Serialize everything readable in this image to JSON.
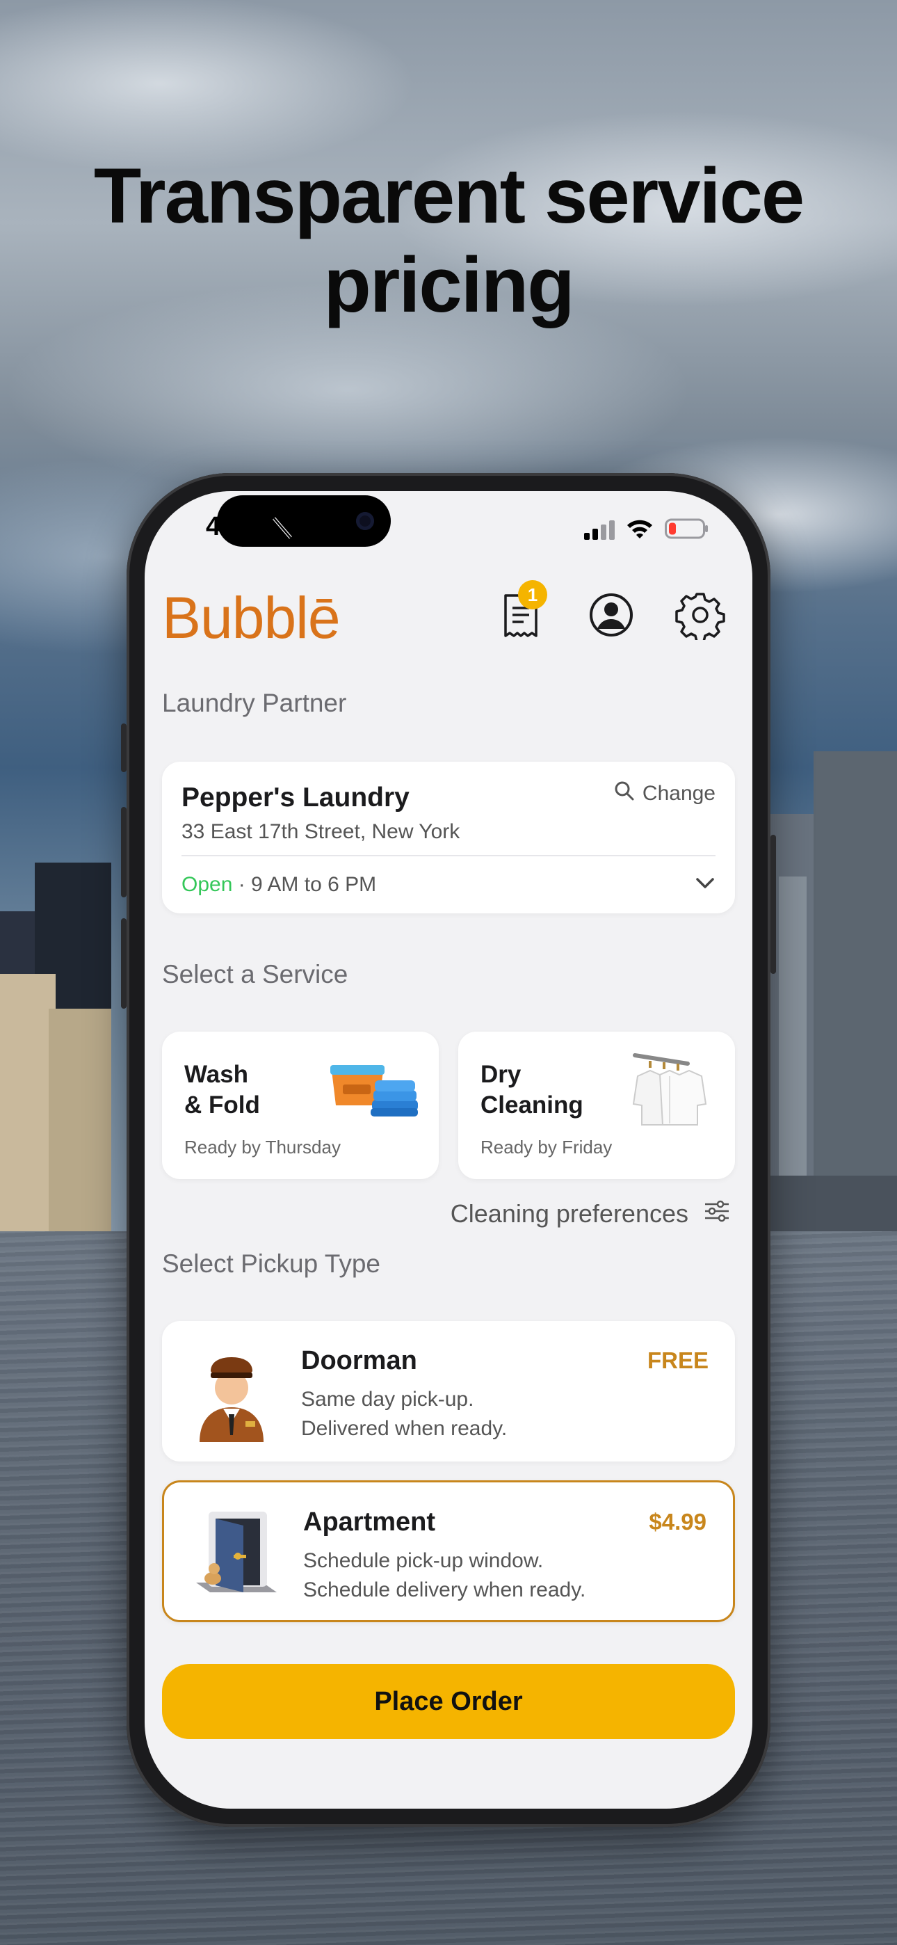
{
  "headline": {
    "line1": "Transparent service",
    "line2": "pricing"
  },
  "status_bar": {
    "time": "4:38",
    "icons": [
      "bell-slash-icon",
      "signal-icon",
      "wifi-icon",
      "battery-low-icon"
    ]
  },
  "app": {
    "logo": "Bubblē",
    "header_icons": [
      "receipt-icon",
      "profile-icon",
      "gear-icon"
    ],
    "receipt_badge": "1",
    "brand_color": "#d9731a",
    "accent_color": "#f5b400"
  },
  "partner_section": {
    "title": "Laundry Partner",
    "name": "Pepper's Laundry",
    "address": "33 East 17th Street, New York",
    "change_label": "Change",
    "status": "Open",
    "hours": " · 9 AM to 6 PM"
  },
  "service_section": {
    "title": "Select a Service",
    "services": [
      {
        "name_line1": "Wash",
        "name_line2": "& Fold",
        "ready": "Ready by Thursday",
        "icon": "laundry-basket-icon"
      },
      {
        "name_line1": "Dry",
        "name_line2": "Cleaning",
        "ready": "Ready by Friday",
        "icon": "shirts-on-hangers-icon"
      }
    ],
    "preferences_label": "Cleaning preferences"
  },
  "pickup_section": {
    "title": "Select Pickup Type",
    "options": [
      {
        "name": "Doorman",
        "price": "FREE",
        "line1": "Same day pick-up.",
        "line2": "Delivered when ready.",
        "icon": "doorman-icon",
        "selected": false
      },
      {
        "name": "Apartment",
        "price": "$4.99",
        "line1": "Schedule pick-up window.",
        "line2": "Schedule delivery when ready.",
        "icon": "apartment-door-icon",
        "selected": true
      }
    ]
  },
  "cta": {
    "label": "Place Order"
  }
}
